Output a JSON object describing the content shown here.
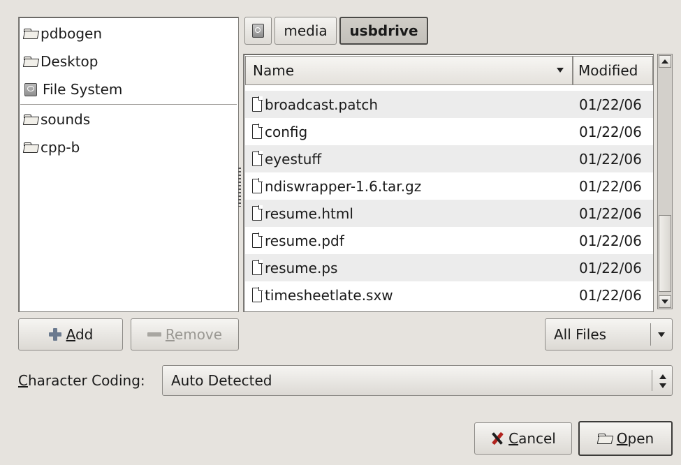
{
  "places": {
    "items": [
      {
        "label": "pdbogen",
        "icon": "folder-icon"
      },
      {
        "label": "Desktop",
        "icon": "folder-icon"
      },
      {
        "label": "File System",
        "icon": "filesystem-icon"
      }
    ],
    "bookmarks": [
      {
        "label": "sounds",
        "icon": "folder-icon"
      },
      {
        "label": "cpp-b",
        "icon": "folder-icon"
      }
    ]
  },
  "pathbar": {
    "segments": [
      "media",
      "usbdrive"
    ],
    "active": "usbdrive"
  },
  "filelist": {
    "columns": [
      "Name",
      "Modified"
    ],
    "rows": [
      {
        "name": "broadcast.patch",
        "modified": "01/22/06"
      },
      {
        "name": "config",
        "modified": "01/22/06"
      },
      {
        "name": "eyestuff",
        "modified": "01/22/06"
      },
      {
        "name": "ndiswrapper-1.6.tar.gz",
        "modified": "01/22/06"
      },
      {
        "name": "resume.html",
        "modified": "01/22/06"
      },
      {
        "name": "resume.pdf",
        "modified": "01/22/06"
      },
      {
        "name": "resume.ps",
        "modified": "01/22/06"
      },
      {
        "name": "timesheetlate.sxw",
        "modified": "01/22/06"
      }
    ]
  },
  "buttons": {
    "add": {
      "pre": "",
      "mnemonic": "A",
      "post": "dd"
    },
    "remove": {
      "pre": "",
      "mnemonic": "R",
      "post": "emove"
    },
    "cancel": {
      "pre": "",
      "mnemonic": "C",
      "post": "ancel"
    },
    "open": {
      "pre": "",
      "mnemonic": "O",
      "post": "pen"
    }
  },
  "filter": {
    "selected": "All Files"
  },
  "coding": {
    "label": {
      "mnemonic": "C",
      "post": "haracter Coding:"
    },
    "selected": "Auto Detected"
  },
  "colors": {
    "background": "#e6e3de",
    "row_alt": "#ececec",
    "cancel_accent": "#b2231e"
  }
}
